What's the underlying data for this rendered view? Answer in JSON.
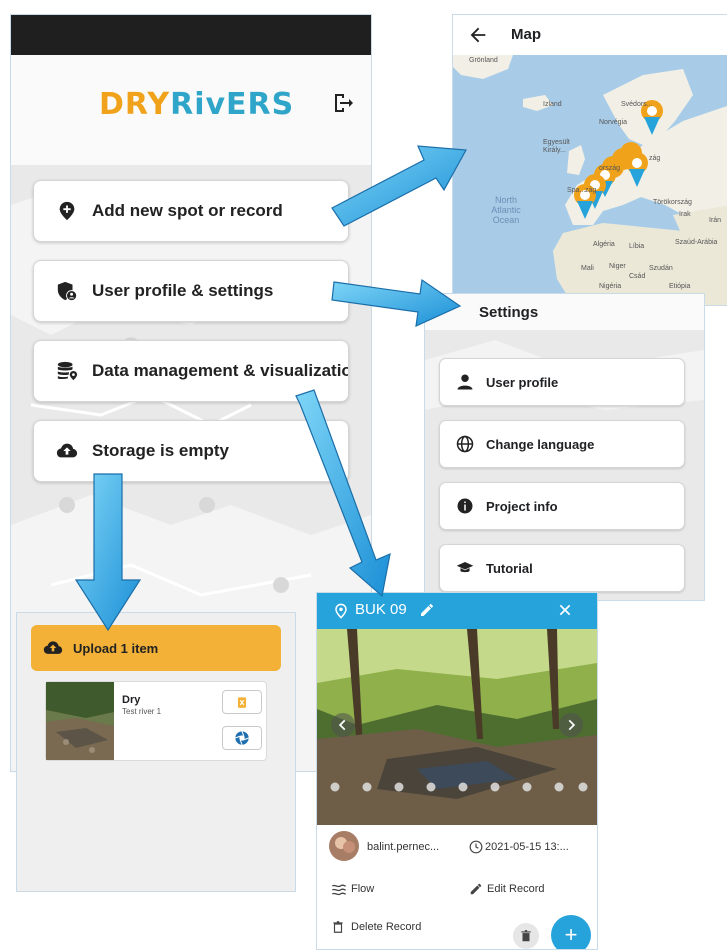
{
  "main": {
    "logo_text_part1": "DRY",
    "logo_text_part2": "RivERS",
    "menu": [
      {
        "label": "Add new spot or record",
        "icon": "map-pin-plus-icon"
      },
      {
        "label": "User profile & settings",
        "icon": "user-shield-icon"
      },
      {
        "label": "Data management & visualization",
        "icon": "database-pin-icon"
      },
      {
        "label": "Storage is empty",
        "icon": "cloud-upload-icon"
      }
    ]
  },
  "map": {
    "title": "Map",
    "labels": {
      "groenland": "Grönland",
      "izland": "Izland",
      "svedorszag": "Svédors...",
      "norvegia": "Norvégia",
      "egyesult": "Egyesült Király...",
      "spanyol": "Spa...",
      "zag1": "zág",
      "zag2": "ország",
      "zag3": "zág",
      "torokorszag": "Törökország",
      "irak": "Irak",
      "iran": "Irán",
      "algeria": "Algéria",
      "libia": "Líbia",
      "szaud": "Szaúd-Arábia",
      "mali": "Mali",
      "niger": "Niger",
      "szudan": "Szudán",
      "csad": "Csád",
      "nigeria": "Nigéria",
      "etiopia": "Etiópia",
      "ocean": "North Atlantic Ocean"
    }
  },
  "settings": {
    "title": "Settings",
    "items": [
      {
        "label": "User profile",
        "icon": "person-icon"
      },
      {
        "label": "Change language",
        "icon": "globe-icon"
      },
      {
        "label": "Project info",
        "icon": "info-icon"
      },
      {
        "label": "Tutorial",
        "icon": "graduation-cap-icon"
      }
    ]
  },
  "upload": {
    "button_label": "Upload 1 item",
    "item_title": "Dry",
    "item_subtitle": "Test river 1"
  },
  "record": {
    "title": "BUK 09",
    "user": "balint.pernec...",
    "datetime": "2021-05-15 13:...",
    "flow_label": "Flow",
    "edit_label": "Edit Record",
    "delete_label": "Delete Record",
    "fab_label": "+"
  },
  "colors": {
    "accent_blue": "#27a3dc",
    "upload_orange": "#f3b237",
    "map_pin_orange": "#f0a21a"
  }
}
